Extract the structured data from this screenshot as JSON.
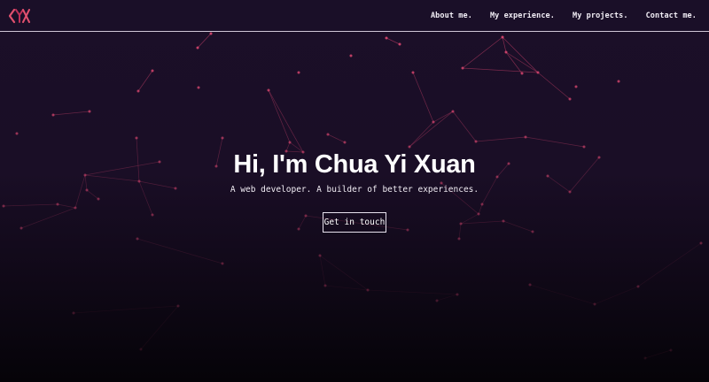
{
  "logo": {
    "text": "CYX",
    "icon": "cyx-logo-icon",
    "color_primary": "#e0506e",
    "color_secondary": "#c03058"
  },
  "nav": {
    "items": [
      {
        "label": "About me."
      },
      {
        "label": "My experience."
      },
      {
        "label": "My projects."
      },
      {
        "label": "Contact me."
      }
    ]
  },
  "hero": {
    "title": "Hi, I'm Chua Yi Xuan",
    "subtitle": "A web developer. A builder of better experiences.",
    "cta_label": "Get in touch"
  },
  "colors": {
    "background_top": "#1b0f28",
    "background_bottom": "#050308",
    "particle": "#d9466f",
    "header_border": "#cfc6d6"
  }
}
